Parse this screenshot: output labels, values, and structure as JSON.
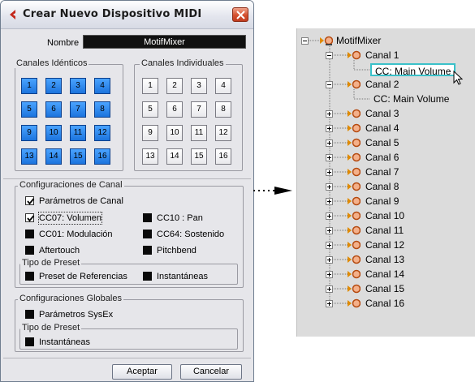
{
  "dialog": {
    "title": "Crear Nuevo Dispositivo MIDI",
    "name_label": "Nombre",
    "name_value": "MotifMixer",
    "identical_channels": {
      "label": "Canales Idénticos",
      "buttons": [
        "1",
        "2",
        "3",
        "4",
        "5",
        "6",
        "7",
        "8",
        "9",
        "10",
        "11",
        "12",
        "13",
        "14",
        "15",
        "16"
      ]
    },
    "individual_channels": {
      "label": "Canales Individuales",
      "buttons": [
        "1",
        "2",
        "3",
        "4",
        "5",
        "6",
        "7",
        "8",
        "9",
        "10",
        "11",
        "12",
        "13",
        "14",
        "15",
        "16"
      ]
    },
    "channel_settings": {
      "label": "Configuraciones de Canal",
      "options": {
        "channel_params": "Parámetros de Canal",
        "cc07": "CC07: Volumen",
        "cc01": "CC01: Modulación",
        "aftertouch": "Aftertouch",
        "cc10": "CC10 : Pan",
        "cc64": "CC64: Sostenido",
        "pitchbend": "Pitchbend"
      },
      "preset_type": {
        "label": "Tipo de Preset",
        "reference": "Preset de Referencias",
        "snapshots": "Instantáneas"
      }
    },
    "global_settings": {
      "label": "Configuraciones Globales",
      "sysex": "Parámetros SysEx",
      "preset_type": {
        "label": "Tipo de Preset",
        "snapshots": "Instantáneas"
      }
    },
    "ok_label": "Aceptar",
    "cancel_label": "Cancelar"
  },
  "tree": {
    "root": "MotifMixer",
    "channels": [
      "Canal 1",
      "Canal 2",
      "Canal 3",
      "Canal 4",
      "Canal 5",
      "Canal 6",
      "Canal 7",
      "Canal 8",
      "Canal 9",
      "Canal 10",
      "Canal 11",
      "Canal 12",
      "Canal 13",
      "Canal 14",
      "Canal 15",
      "Canal 16"
    ],
    "canal1_child": "CC: Main Volume",
    "canal2_child": "CC: Main Volume"
  }
}
